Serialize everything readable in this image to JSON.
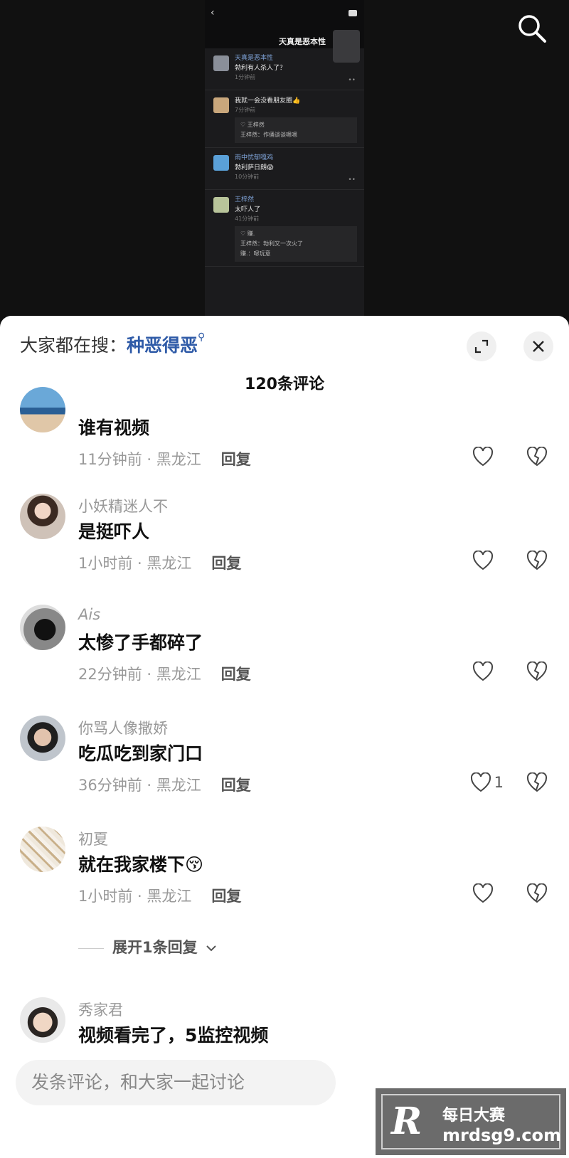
{
  "video": {
    "header_name": "天真是恶本性",
    "mini_comments": [
      {
        "name": "天真是恶本性",
        "text": "勃利有人杀人了？",
        "time": "1分钟前"
      },
      {
        "name": "",
        "text": "我就一会没看朋友圈👍",
        "time": "7分钟前",
        "reply_name": "♡ 王梓然",
        "reply_text": "王梓然：作俑谈谈嗯嗯"
      },
      {
        "name": "雨中忧郁嘎鸡",
        "text": "勃利萨日朗😱",
        "time": "10分钟前"
      },
      {
        "name": "王梓然",
        "text": "太吓人了",
        "time": "41分钟前",
        "reply_name": "♡ 赚.",
        "reply_text": "王梓然：勃利又一次火了",
        "reply_text2": "赚.：嗯玩意"
      }
    ]
  },
  "sheet": {
    "hot_search_label": "大家都在搜：",
    "hot_search_keyword": "种恶得恶",
    "comment_count": "120条评论",
    "reply_label": "回复",
    "expand_replies": "展开1条回复"
  },
  "comments": [
    {
      "name": "",
      "text": "谁有视频",
      "meta": "11分钟前 · 黑龙江",
      "likes": ""
    },
    {
      "name": "小妖精迷人不",
      "text": "是挺吓人",
      "meta": "1小时前 · 黑龙江",
      "likes": ""
    },
    {
      "name": "Ais",
      "text": "太惨了手都碎了",
      "meta": "22分钟前 · 黑龙江",
      "likes": ""
    },
    {
      "name": "你骂人像撒娇",
      "text": "吃瓜吃到家门口",
      "meta": "36分钟前 · 黑龙江",
      "likes": "1"
    },
    {
      "name": "初夏",
      "text": "就在我家楼下😚",
      "meta": "1小时前 · 黑龙江",
      "likes": ""
    },
    {
      "name": "秀家君",
      "text": "视频看完了，5监控视频",
      "meta": "",
      "likes": ""
    }
  ],
  "input": {
    "placeholder": "发条评论，和大家一起讨论"
  },
  "watermark": {
    "letter": "R",
    "cn": "每日大赛",
    "url": "mrdsg9.com"
  },
  "colors": {
    "keyword": "#2e5aa7",
    "sheet_bg": "#ffffff",
    "video_bg": "#111111"
  }
}
